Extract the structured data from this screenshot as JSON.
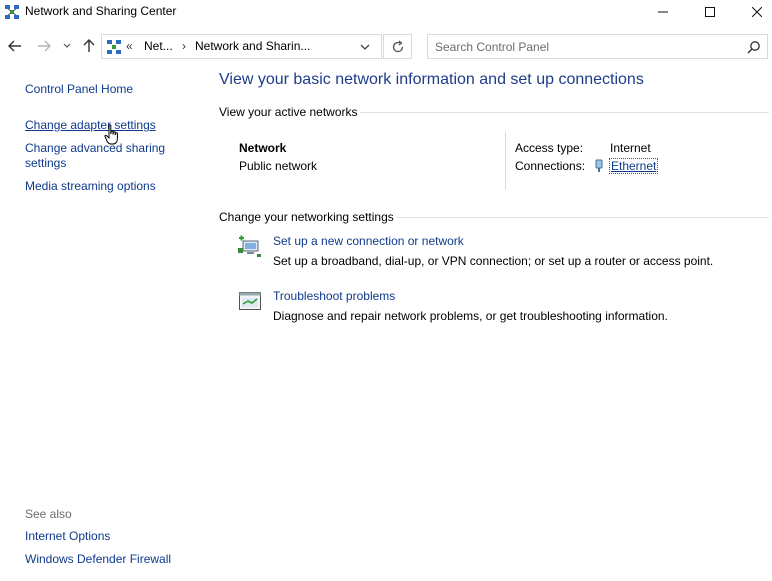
{
  "window": {
    "title": "Network and Sharing Center"
  },
  "address": {
    "overflow": "«",
    "crumb1": "Net...",
    "crumb2": "Network and Sharin..."
  },
  "search": {
    "placeholder": "Search Control Panel"
  },
  "sidebar": {
    "home": "Control Panel Home",
    "adapter": "Change adapter settings",
    "advanced": "Change advanced sharing settings",
    "media": "Media streaming options",
    "see_also": "See also",
    "internet_options": "Internet Options",
    "firewall": "Windows Defender Firewall"
  },
  "main": {
    "title": "View your basic network information and set up connections",
    "active_networks_label": "View your active networks",
    "network": {
      "name": "Network",
      "type": "Public network",
      "access_type_label": "Access type:",
      "access_type_value": "Internet",
      "connections_label": "Connections:",
      "connection_name": "Ethernet"
    },
    "change_settings_label": "Change your networking settings",
    "tasks": [
      {
        "icon": "new-connection-icon",
        "link": "Set up a new connection or network",
        "desc": "Set up a broadband, dial-up, or VPN connection; or set up a router or access point."
      },
      {
        "icon": "troubleshoot-icon",
        "link": "Troubleshoot problems",
        "desc": "Diagnose and repair network problems, or get troubleshooting information."
      }
    ]
  },
  "colors": {
    "link": "#0f3a8c",
    "title": "#1e3c8a",
    "muted": "#6d6d6d"
  }
}
